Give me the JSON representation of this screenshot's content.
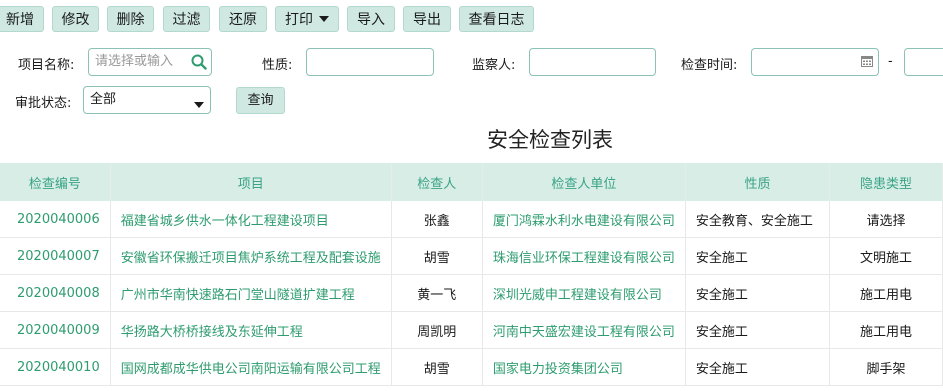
{
  "toolbar": {
    "add": "新增",
    "edit": "修改",
    "delete": "删除",
    "filter": "过滤",
    "restore": "还原",
    "print": "打印",
    "import": "导入",
    "export": "导出",
    "view_log": "查看日志"
  },
  "filters": {
    "project_label": "项目名称:",
    "project_placeholder": "请选择或输入",
    "nature_label": "性质:",
    "supervisor_label": "监察人:",
    "check_time_label": "检查时间:",
    "date_separator": "-",
    "approval_label": "审批状态:",
    "approval_value": "全部",
    "query_button": "查询"
  },
  "table": {
    "title": "安全检查列表",
    "columns": [
      "检查编号",
      "项目",
      "检查人",
      "检查人单位",
      "性质",
      "隐患类型"
    ],
    "rows": [
      [
        "2020040006",
        "福建省城乡供水一体化工程建设项目",
        "张鑫",
        "厦门鸿霖水利水电建设有限公司",
        "安全教育、安全施工",
        "请选择"
      ],
      [
        "2020040007",
        "安徽省环保搬迁项目焦炉系统工程及配套设施",
        "胡雪",
        "珠海信业环保工程建设有限公司",
        "安全施工",
        "文明施工"
      ],
      [
        "2020040008",
        "广州市华南快速路石门堂山隧道扩建工程",
        "黄一飞",
        "深圳光威申工程建设有限公司",
        "安全施工",
        "施工用电"
      ],
      [
        "2020040009",
        "华扬路大桥桥接线及东延伸工程",
        "周凯明",
        "河南中天盛宏建设工程有限公司",
        "安全施工",
        "施工用电"
      ],
      [
        "2020040010",
        "国网成都成华供电公司南阳运输有限公司工程",
        "胡雪",
        "国家电力投资集团公司",
        "安全施工",
        "脚手架"
      ]
    ]
  },
  "colors": {
    "accent": "#2e9c6f",
    "header_bg": "#d7ede6",
    "button_bg": "#cfe9e2"
  }
}
